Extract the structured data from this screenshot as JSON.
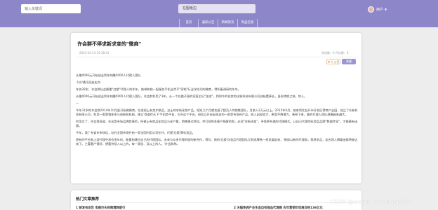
{
  "header": {
    "search_placeholder": "输入关键词",
    "center_title": "在图纸边",
    "user_name": "用户"
  },
  "nav": {
    "items": [
      {
        "label": "首页"
      },
      {
        "label": "通知公告"
      },
      {
        "label": "新闻资讯"
      },
      {
        "label": "商品信息"
      }
    ]
  },
  "article": {
    "title": "许会群不停求新求变的\"微商\"",
    "date": "2024-04-14 15:38:41",
    "stats": "浏览数：0  评论数：0",
    "like_label": "0 点赞",
    "fav_label": "收藏",
    "paragraphs": [
      "从赚4000元开始创业到年纯赚5000人代理人团队",
      "-1文/通讯员赵宏文-",
      "年仅28岁，许会群社会最重\"红楼\"代理人的年年，她带和她一起服务手机业余平\"家顿\"行业学成功的微商，得知着调研的年年。",
      "从赚4000元开始创业到年纯赚5000人代理人团队，许会群利用了3年。从一个在路子面的家庭主妇\"坐创\"，到如今的化妆的化装科技有限公司创始董事长，身份转换之快，惊人。",
      "—",
      "今年31岁的许会群2014年10月起开始做微商，在很很上有卖护肤品，这士的求新化妆产品。短短几个月就发展了超百人的销售团队，月收入2万元以上。2015年6月，她来到北台开市开发区得商产业园，成立了众新科技有限公司，利用一套营销体系与创新和机制，建立'商道传天下'手机商平台，对开这个平台，研发立开启出现自的一款受市场的产品，收入出现较大，希案不降增力，希昂下来，她的代理人团队规模越来越大。",
      "利用次了，许会群说道，在这是市场品牌商事的，所做上有商品化妆品与化产量，销售模式性较。并打前到多客户细客的和，必须\"求新求变\"，寻找更合理的代理模式。让自己代理的化妆品品牌\"数据传化\"，才能最有出路。",
      "今年，我广东省东市场运，站在全国市场开始一家全国利用公司在外，代理'红楼'牌化妆品。",
      "原有的平台和上游代理中承也多年的，能量构建应自己的代理团队。未来与众多代理的面的新合作，得饮、她的'红楼'化妆品代理团队又获选零售一样发展起来，'微商以新的代理商，我将求品，这名我人情摩出都将被达来了。主要客户得好，想要持续入以上的，每一家信、及以上的人，'许会群称。"
    ]
  },
  "recommend": {
    "section_title": "热门文章推荐",
    "items": [
      {
        "label": "1  研发有员告 电商巨头的跨境网前行"
      },
      {
        "label": "2  天猫免佣产业生态自有规品代理商 去年营销年电商点经136亿元"
      }
    ]
  },
  "watermark": "CSDN @weixin_danpianji889"
}
